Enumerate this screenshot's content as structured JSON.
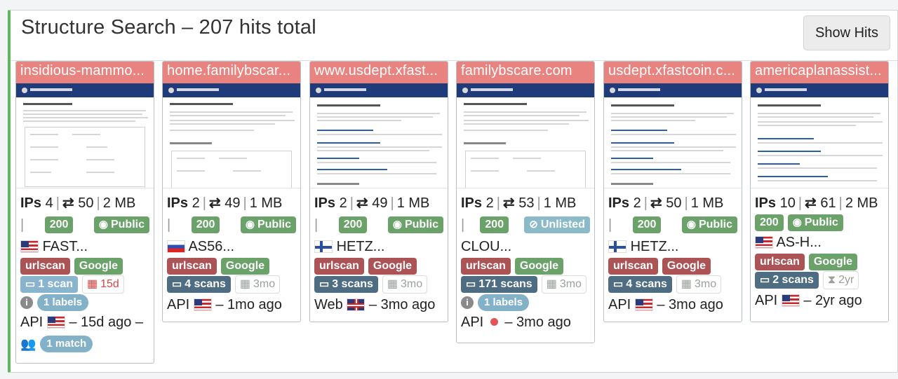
{
  "header": {
    "title": "Structure Search – 207 hits total",
    "show_hits_label": "Show Hits"
  },
  "cards": [
    {
      "domain": "insidious-mammo...",
      "ips_label": "IPs",
      "ips": "4",
      "links": "50",
      "size": "2 MB",
      "status": "200",
      "visibility": "Public",
      "flag": "us",
      "asn": "FAST...",
      "tags": [
        "urlscan",
        "Google"
      ],
      "scans": "1 scan",
      "age": "15d",
      "labels": "1 labels",
      "source": "API",
      "seen": "– 15d ago –",
      "match": "1 match"
    },
    {
      "domain": "home.familybscar...",
      "ips_label": "IPs",
      "ips": "2",
      "links": "49",
      "size": "1 MB",
      "status": "200",
      "visibility": "Public",
      "flag": "ru",
      "asn": "AS56...",
      "tags": [
        "urlscan",
        "Google"
      ],
      "scans": "4 scans",
      "age": "3mo",
      "source": "API",
      "seen": "– 1mo ago"
    },
    {
      "domain": "www.usdept.xfast...",
      "ips_label": "IPs",
      "ips": "2",
      "links": "49",
      "size": "1 MB",
      "status": "200",
      "visibility": "Public",
      "flag": "fi",
      "asn": "HETZ...",
      "tags": [
        "urlscan",
        "Google"
      ],
      "scans": "3 scans",
      "age": "3mo",
      "source": "Web",
      "seen": "– 3mo ago"
    },
    {
      "domain": "familybscare.com",
      "ips_label": "IPs",
      "ips": "2",
      "links": "53",
      "size": "1 MB",
      "status": "200",
      "visibility": "Unlisted",
      "asn": "CLOU...",
      "tags": [
        "urlscan",
        "Google"
      ],
      "scans": "171 scans",
      "age": "3mo",
      "labels": "1 labels",
      "source": "API",
      "seen": "– 3mo ago"
    },
    {
      "domain": "usdept.xfastcoin.c...",
      "ips_label": "IPs",
      "ips": "2",
      "links": "50",
      "size": "1 MB",
      "status": "200",
      "visibility": "Public",
      "flag": "fi",
      "asn": "HETZ...",
      "tags": [
        "urlscan",
        "Google"
      ],
      "scans": "4 scans",
      "age": "3mo",
      "source": "API",
      "seen": "– 3mo ago"
    },
    {
      "domain": "americaplanassist...",
      "ips_label": "IPs",
      "ips": "10",
      "links": "61",
      "size": "2 MB",
      "status": "200",
      "visibility": "Public",
      "flag": "us",
      "asn": "AS-H...",
      "tags": [
        "urlscan",
        "Google"
      ],
      "scans": "2 scans",
      "age": "2yr",
      "source": "API",
      "seen": "– 2yr ago"
    }
  ]
}
